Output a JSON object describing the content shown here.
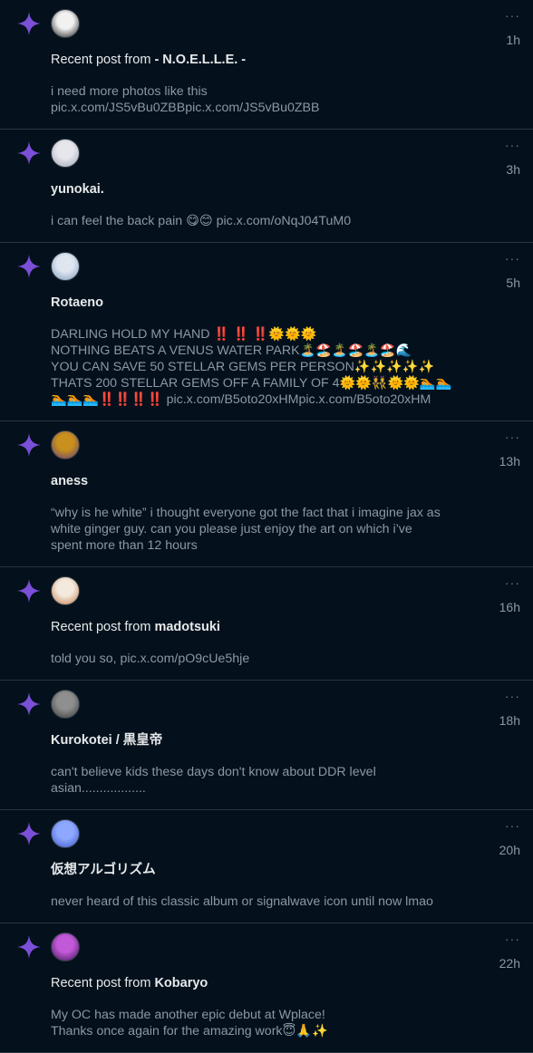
{
  "notifications": [
    {
      "prefix": "Recent post from",
      "name": "- N.O.E.L.L.E. -",
      "time": "1h",
      "text": "i need more photos like this\npic.x.com/JS5vBu0ZBBpic.x.com/JS5vBu0ZBB",
      "avatar_colors": [
        "#f1f1f1",
        "#1a1a1a"
      ]
    },
    {
      "prefix": "",
      "name": "yunokai.",
      "time": "3h",
      "text": "i can feel the back pain 😋😊 pic.x.com/oNqJ04TuM0",
      "avatar_colors": [
        "#e6e6ec",
        "#9da3b4"
      ]
    },
    {
      "prefix": "",
      "name": "Rotaeno",
      "time": "5h",
      "text": "DARLING HOLD MY HAND ‼️ ‼️ ‼️🌞🌞🌞\nNOTHING BEATS A VENUS WATER PARK🏝️🏖️🏝️🏖️🏝️🏖️🌊\nYOU CAN SAVE 50 STELLAR GEMS PER PERSON✨✨✨✨✨\nTHATS 200 STELLAR GEMS OFF A FAMILY OF 4🌞🌞👯🌞🌞🏊🏊\n🏊🏊🏊‼️‼️‼️‼️ pic.x.com/B5oto20xHMpic.x.com/B5oto20xHM",
      "avatar_colors": [
        "#dfe6ef",
        "#7d9bbd"
      ]
    },
    {
      "prefix": "",
      "name": "aness",
      "time": "13h",
      "text": "“why is he white” i thought everyone got the fact that i imagine jax as\nwhite ginger guy. can you please just enjoy the art on which i’ve\nspent more than 12 hours",
      "avatar_colors": [
        "#c9901d",
        "#5c3a7a"
      ]
    },
    {
      "prefix": "Recent post from",
      "name": "madotsuki",
      "time": "16h",
      "text": "told you so, pic.x.com/pO9cUe5hje",
      "avatar_colors": [
        "#f3e9dc",
        "#c4784a"
      ]
    },
    {
      "prefix": "",
      "name": "Kurokotei / 黒皇帝",
      "time": "18h",
      "text": "can't believe kids these days don't know about DDR level\nasian..................",
      "avatar_colors": [
        "#8f8f8f",
        "#3a3a3a"
      ]
    },
    {
      "prefix": "",
      "name": "仮想アルゴリズム",
      "time": "20h",
      "text": "never heard of this classic album or signalwave icon until now lmao",
      "avatar_colors": [
        "#8ea8ff",
        "#3a55c8"
      ]
    },
    {
      "prefix": "Recent post from",
      "name": "Kobaryo",
      "time": "22h",
      "text": "My OC has made another epic debut at Wplace!\nThanks once again for the amazing work😇🙏✨",
      "avatar_colors": [
        "#c25ad8",
        "#3a1354"
      ]
    }
  ],
  "more_label": "···",
  "colors": {
    "background": "#04111c",
    "star": "#7b4fd8",
    "divider": "#283640",
    "muted_text": "#8b98a5"
  },
  "icons": {
    "star": "sparkle-star-icon",
    "more": "more-options-icon"
  }
}
